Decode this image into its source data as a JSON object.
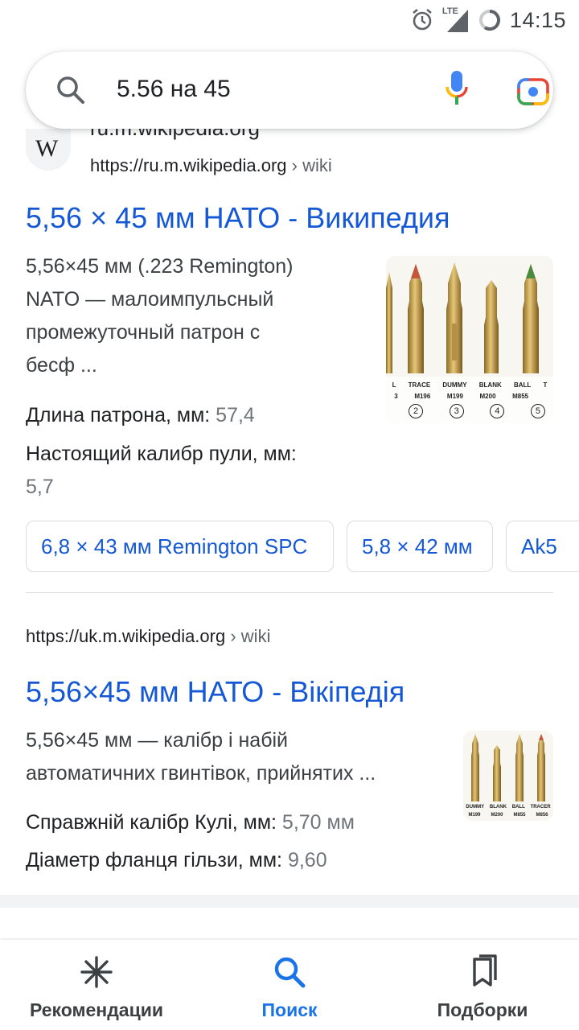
{
  "status_bar": {
    "time": "14:15",
    "network": "LTE",
    "icons": [
      "alarm-icon",
      "signal-icon",
      "battery-icon"
    ]
  },
  "search": {
    "query": "5.56 на 45",
    "icons": [
      "search-icon",
      "mic-icon",
      "lens-icon"
    ]
  },
  "result1": {
    "site_name": "ru.m.wikipedia.org",
    "logo_letter": "W",
    "url": "https://ru.m.wikipedia.org",
    "crumb": "› wiki",
    "title": "5,56 × 45 мм НАТО - Википедия",
    "snippet_lines": [
      "5,56×45 мм (.223 Remington)",
      "NATO — малоимпульсный",
      "промежуточный патрон с",
      "бесф ..."
    ],
    "facts": [
      {
        "label": "Длина патрона, мм:",
        "value": "57,4"
      },
      {
        "label": "Настоящий калибр пули, мм:",
        "value": "5,7"
      }
    ],
    "thumb_labels": [
      "L",
      "TRACE",
      "DUMMY",
      "BLANK",
      "BALL",
      "T"
    ],
    "thumb_models": [
      "3",
      "M196",
      "M199",
      "M200",
      "M855",
      ""
    ],
    "thumb_numbers": [
      "",
      "2",
      "3",
      "4",
      "5",
      ""
    ],
    "chips": [
      "6,8 × 43 мм Remington SPC",
      "5,8 × 42 мм",
      "Ak5"
    ]
  },
  "result2": {
    "url": "https://uk.m.wikipedia.org",
    "crumb": "› wiki",
    "title": "5,56×45 мм НАТО - Вікіпедія",
    "snippet_lines": [
      "5,56×45 мм — калібр і набій",
      "автоматичних гвинтівок, прийнятих ..."
    ],
    "facts": [
      {
        "label": "Справжній калібр Кулі, мм:",
        "value": "5,70 мм"
      },
      {
        "label": "Діаметр фланця гільзи, мм:",
        "value": "9,60"
      }
    ],
    "thumb_labels": [
      "DUMMY",
      "BLANK",
      "BALL",
      "TRACER"
    ],
    "thumb_models": [
      "M199",
      "M200",
      "M855",
      "M856"
    ]
  },
  "bottom_nav": {
    "items": [
      {
        "label": "Рекомендации",
        "icon": "asterisk-icon"
      },
      {
        "label": "Поиск",
        "icon": "search-icon"
      },
      {
        "label": "Подборки",
        "icon": "collections-icon"
      }
    ],
    "active": "Поиск",
    "active_color": "#1a73e8"
  },
  "colors": {
    "link": "#1558d6",
    "text": "#202124",
    "muted": "#70757a"
  }
}
